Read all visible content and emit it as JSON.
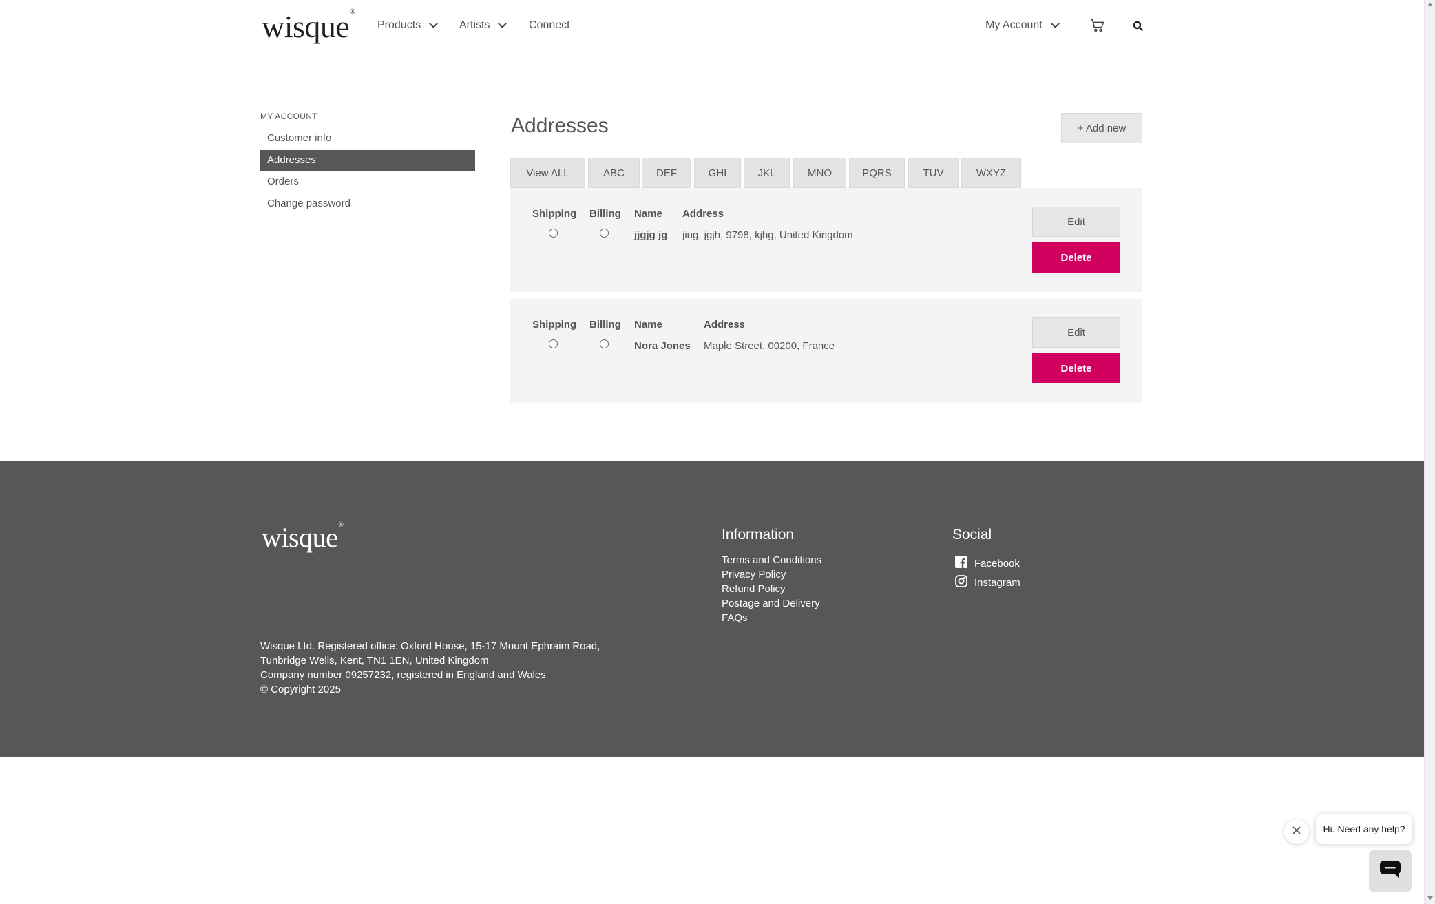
{
  "header": {
    "logo": "wisque",
    "logo_mark": "®",
    "nav": [
      {
        "label": "Products",
        "has_dropdown": true
      },
      {
        "label": "Artists",
        "has_dropdown": true
      },
      {
        "label": "Connect",
        "has_dropdown": false
      }
    ],
    "account_label": "My Account",
    "icons": [
      "cart-icon",
      "search-icon"
    ]
  },
  "sidebar": {
    "heading": "MY ACCOUNT",
    "items": [
      {
        "label": "Customer info",
        "active": false
      },
      {
        "label": "Addresses",
        "active": true
      },
      {
        "label": "Orders",
        "active": false
      },
      {
        "label": "Change password",
        "active": false
      }
    ]
  },
  "main": {
    "title": "Addresses",
    "add_label": "+ Add new",
    "filters": [
      "View ALL",
      "ABC",
      "DEF",
      "GHI",
      "JKL",
      "MNO",
      "PQRS",
      "TUV",
      "WXYZ"
    ],
    "columns": {
      "shipping": "Shipping",
      "billing": "Billing",
      "name": "Name",
      "address": "Address"
    },
    "addresses": [
      {
        "name": "jjgjg jg",
        "address": "jiug, jgjh, 9798, kjhg, United Kingdom",
        "edit": "Edit",
        "delete": "Delete"
      },
      {
        "name": "Nora Jones",
        "address": "Maple Street, 00200, France",
        "edit": "Edit",
        "delete": "Delete"
      }
    ]
  },
  "footer": {
    "logo": "wisque",
    "logo_mark": "®",
    "information": {
      "heading": "Information",
      "links": [
        "Terms and Conditions",
        "Privacy Policy",
        "Refund Policy",
        "Postage and Delivery",
        "FAQs"
      ]
    },
    "social": {
      "heading": "Social",
      "links": [
        {
          "label": "Facebook",
          "icon": "facebook-icon"
        },
        {
          "label": "Instagram",
          "icon": "instagram-icon"
        }
      ]
    },
    "legal": [
      "Wisque Ltd. Registered office: Oxford House, 15-17 Mount Ephraim Road,",
      "Tunbridge Wells, Kent, TN1 1EN, United Kingdom",
      "Company number 09257232, registered in England and Wales",
      "© Copyright 2025"
    ]
  },
  "chat": {
    "prompt": "Hi. Need any help?"
  },
  "colors": {
    "accent": "#d2005f",
    "footer_bg": "#575757",
    "active_nav": "#575757",
    "card_bg": "#f4f4f4"
  }
}
